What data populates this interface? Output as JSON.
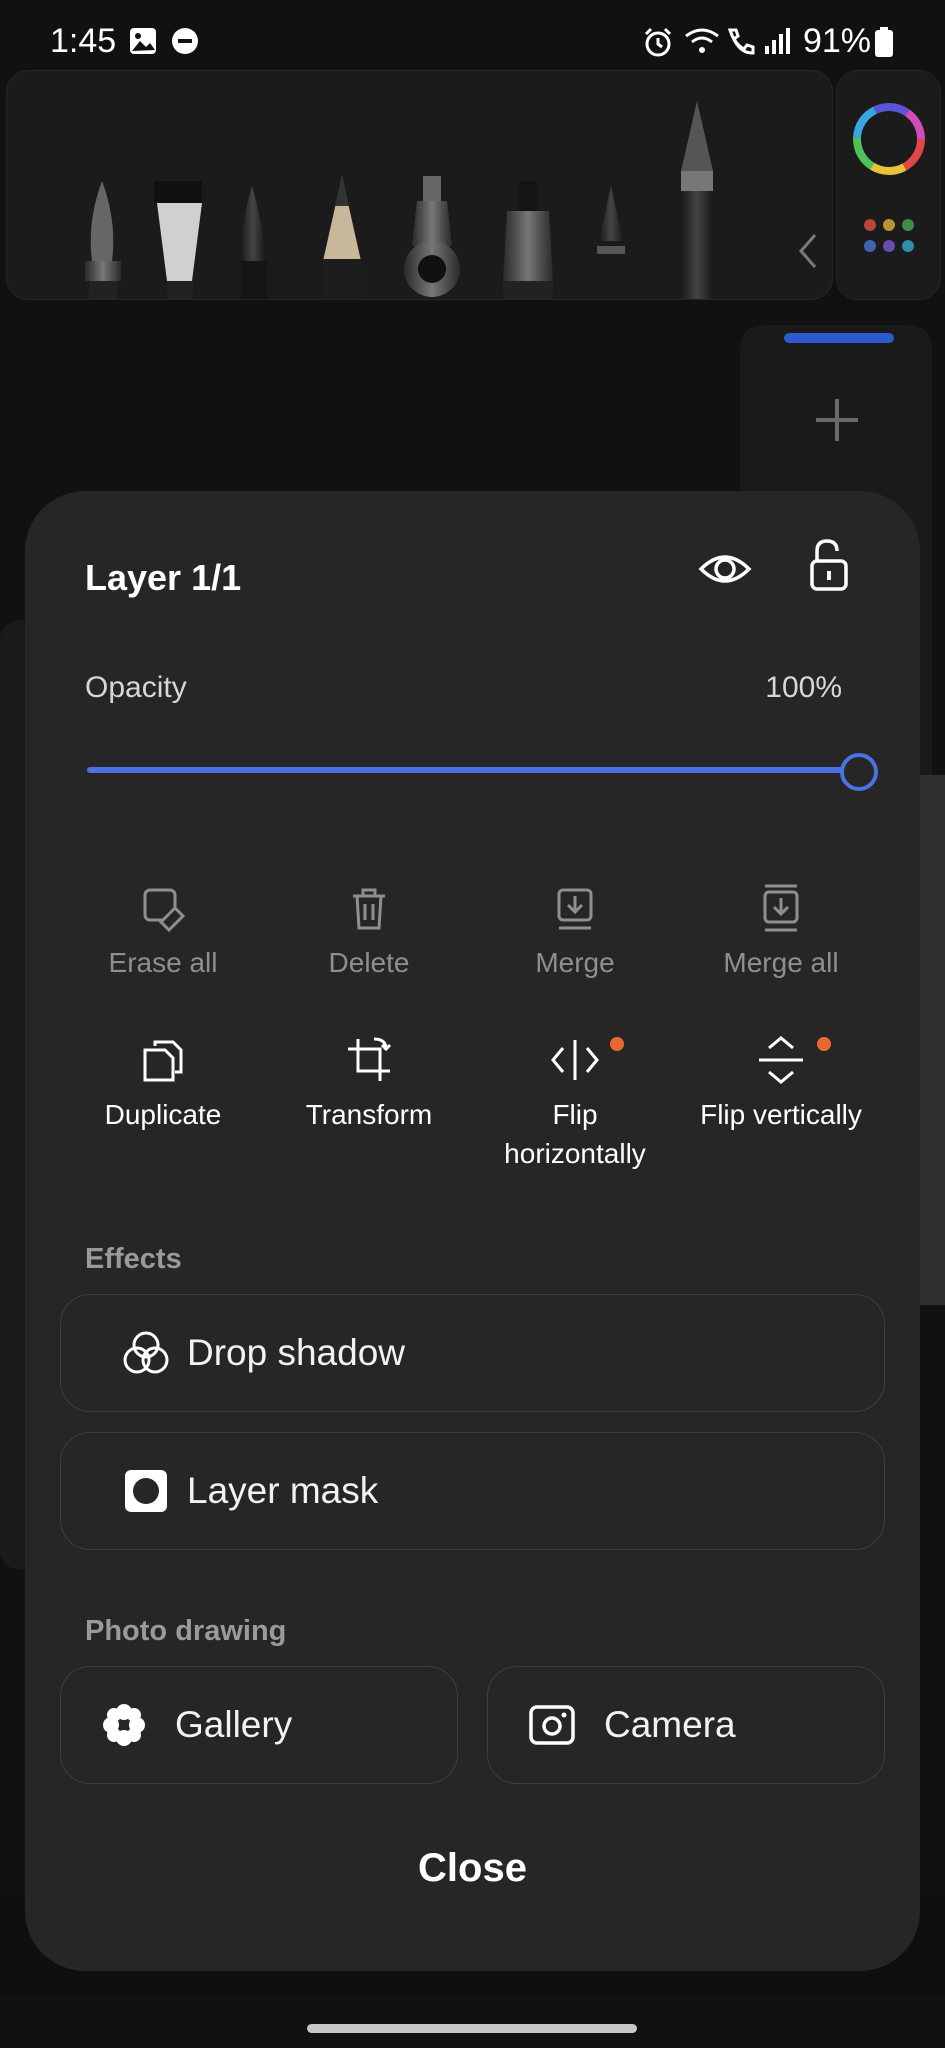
{
  "status": {
    "time": "1:45",
    "battery": "91%"
  },
  "sheet": {
    "title": "Layer 1/1",
    "opacity_label": "Opacity",
    "opacity_value": "100%",
    "opacity": 1.0,
    "actions_row1": [
      "Erase all",
      "Delete",
      "Merge",
      "Merge all"
    ],
    "actions_row2": [
      "Duplicate",
      "Transform",
      "Flip horizontally",
      "Flip vertically"
    ],
    "effects_header": "Effects",
    "effects": [
      "Drop shadow",
      "Layer mask"
    ],
    "photo_header": "Photo drawing",
    "photo": [
      "Gallery",
      "Camera"
    ],
    "close_label": "Close"
  },
  "icons": {
    "status": [
      "gallery-icon",
      "dnd-icon",
      "alarm-icon",
      "wifi-icon",
      "wifi-call-icon",
      "signal-icon",
      "battery-icon"
    ],
    "toolbar": [
      "brush-icon",
      "flat-brush-icon",
      "ink-pen-icon",
      "pencil-icon",
      "airbrush-icon",
      "marker-icon",
      "fine-pen-icon",
      "stylus-icon",
      "chevron-left-icon"
    ]
  },
  "colors": {
    "accent": "#4b72e0",
    "badge": "#e8692f",
    "sheet": "#262626"
  }
}
